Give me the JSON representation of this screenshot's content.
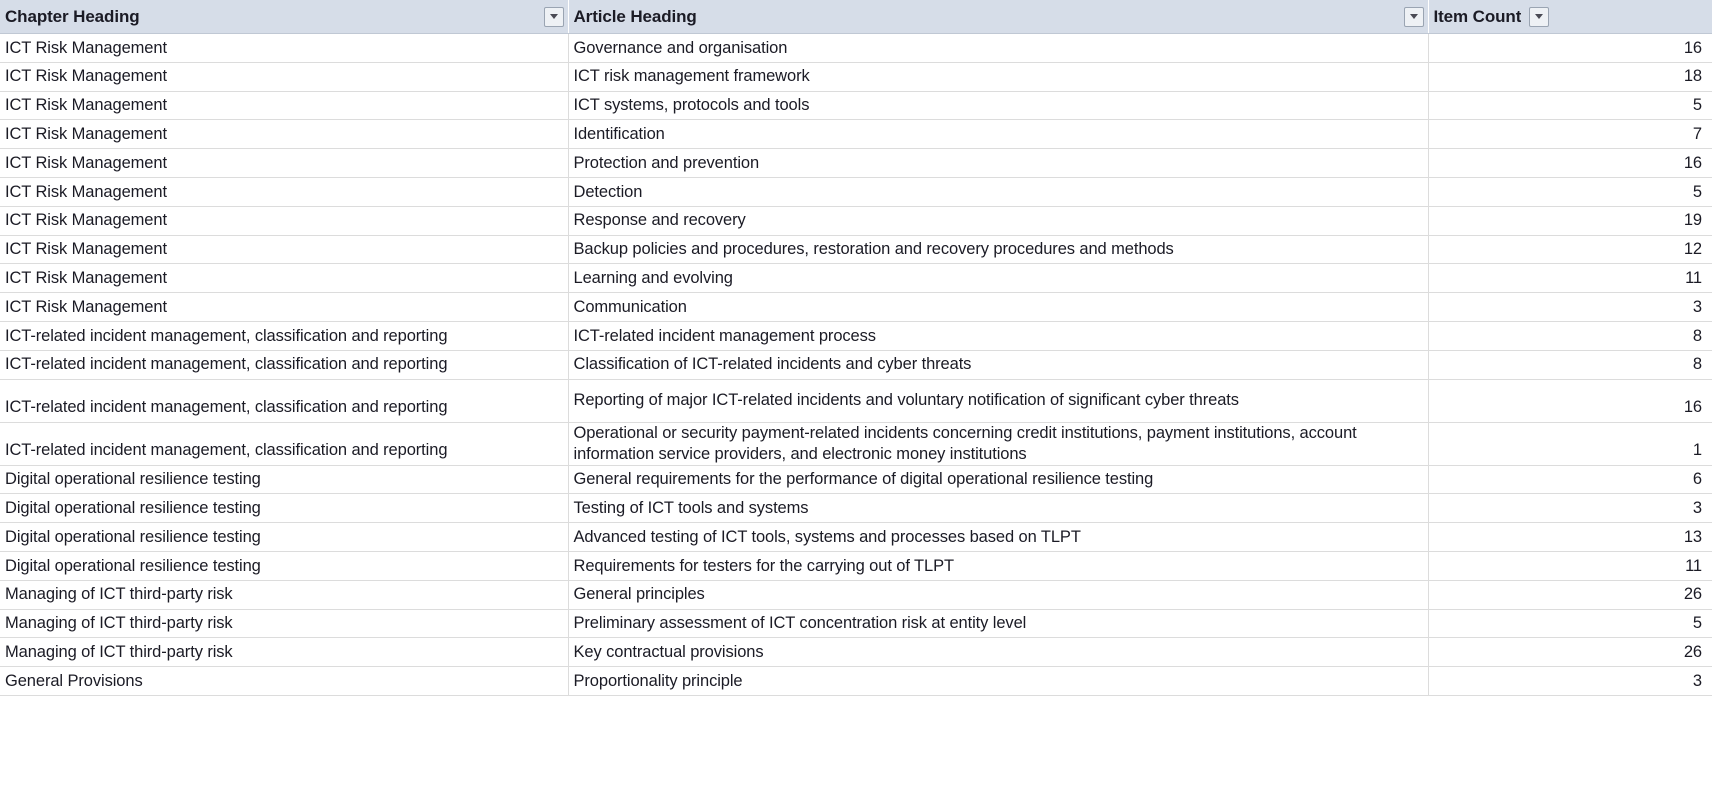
{
  "table": {
    "columns": [
      {
        "key": "chapter",
        "label": "Chapter Heading",
        "filter_icon": "filter-dropdown-icon"
      },
      {
        "key": "article",
        "label": "Article Heading",
        "filter_icon": "filter-dropdown-icon"
      },
      {
        "key": "count",
        "label": "Item Count",
        "filter_icon": "filter-dropdown-icon"
      }
    ],
    "rows": [
      {
        "chapter": "ICT Risk Management",
        "article": "Governance and organisation",
        "count": "16",
        "tall": false
      },
      {
        "chapter": "ICT Risk Management",
        "article": "ICT risk management framework",
        "count": "18",
        "tall": false
      },
      {
        "chapter": "ICT Risk Management",
        "article": "ICT systems, protocols and tools",
        "count": "5",
        "tall": false
      },
      {
        "chapter": "ICT Risk Management",
        "article": "Identification",
        "count": "7",
        "tall": false
      },
      {
        "chapter": "ICT Risk Management",
        "article": "Protection and prevention",
        "count": "16",
        "tall": false
      },
      {
        "chapter": "ICT Risk Management",
        "article": "Detection",
        "count": "5",
        "tall": false
      },
      {
        "chapter": "ICT Risk Management",
        "article": "Response and recovery",
        "count": "19",
        "tall": false
      },
      {
        "chapter": "ICT Risk Management",
        "article": "Backup policies and procedures, restoration and recovery procedures and methods",
        "count": "12",
        "tall": false
      },
      {
        "chapter": "ICT Risk Management",
        "article": "Learning and evolving",
        "count": "11",
        "tall": false
      },
      {
        "chapter": "ICT Risk Management",
        "article": "Communication",
        "count": "3",
        "tall": false
      },
      {
        "chapter": "ICT-related incident management, classification and reporting",
        "article": "ICT-related incident management process",
        "count": "8",
        "tall": false
      },
      {
        "chapter": "ICT-related incident management, classification and reporting",
        "article": "Classification of ICT-related incidents and cyber threats",
        "count": "8",
        "tall": false
      },
      {
        "chapter": "ICT-related incident management, classification and reporting",
        "article": "Reporting of major ICT-related incidents and voluntary notification of significant cyber threats",
        "count": "16",
        "tall": true
      },
      {
        "chapter": "ICT-related incident management, classification and reporting",
        "article": "Operational or security payment-related incidents concerning credit institutions, payment institutions, account information service providers, and electronic money institutions",
        "count": "1",
        "tall": true
      },
      {
        "chapter": "Digital operational resilience testing",
        "article": "General requirements for the performance of digital operational resilience testing",
        "count": "6",
        "tall": false
      },
      {
        "chapter": "Digital operational resilience testing",
        "article": "Testing of ICT tools and systems",
        "count": "3",
        "tall": false
      },
      {
        "chapter": "Digital operational resilience testing",
        "article": "Advanced testing of ICT tools, systems and processes based on TLPT",
        "count": "13",
        "tall": false
      },
      {
        "chapter": "Digital operational resilience testing",
        "article": "Requirements for testers for the carrying out of TLPT",
        "count": "11",
        "tall": false
      },
      {
        "chapter": "Managing of ICT third-party risk",
        "article": "General principles",
        "count": "26",
        "tall": false
      },
      {
        "chapter": "Managing of ICT third-party risk",
        "article": "Preliminary assessment of ICT concentration risk at entity level",
        "count": "5",
        "tall": false
      },
      {
        "chapter": "Managing of ICT third-party risk",
        "article": "Key contractual provisions",
        "count": "26",
        "tall": false
      },
      {
        "chapter": "General Provisions",
        "article": "Proportionality principle",
        "count": "3",
        "tall": false
      }
    ]
  },
  "colors": {
    "header_background": "#d6dde8",
    "header_text": "#1b1b25",
    "gridline": "#dcdcdc",
    "cell_background": "#ffffff",
    "cell_text": "#1b1b25"
  }
}
